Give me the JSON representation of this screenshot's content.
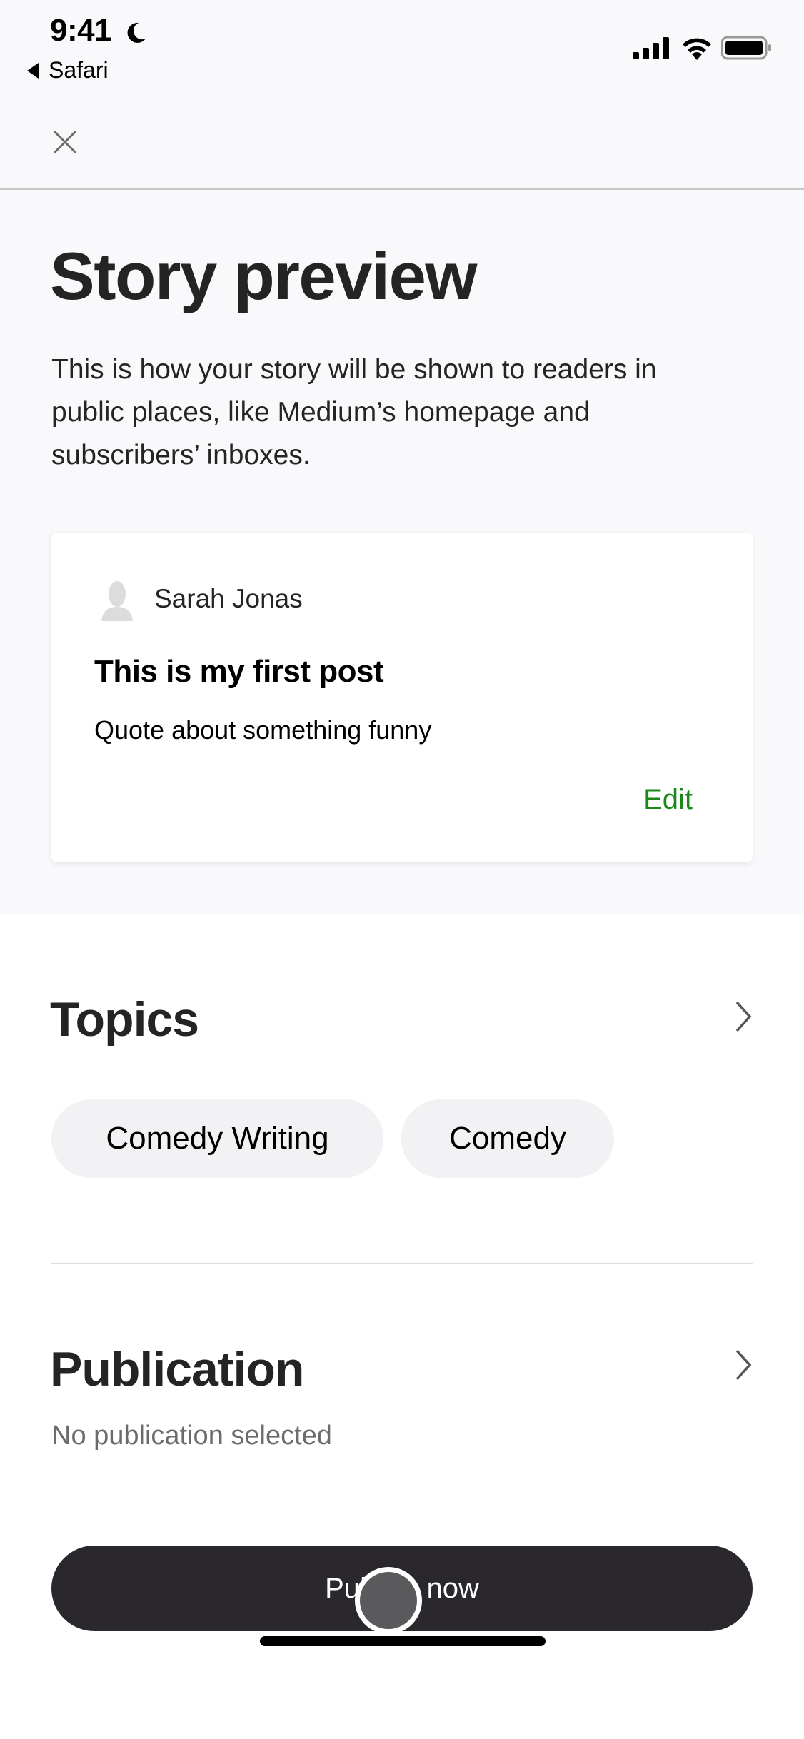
{
  "status_bar": {
    "time": "9:41",
    "back_app": "Safari",
    "icons": [
      "moon-icon",
      "signal-icon",
      "wifi-icon",
      "battery-icon"
    ]
  },
  "header": {
    "close_icon": "close-icon"
  },
  "intro": {
    "title": "Story preview",
    "description": "This is how your story will be shown to readers in public places, like Medium’s homepage and subscribers’ inboxes."
  },
  "preview_card": {
    "author": "Sarah Jonas",
    "post_title": "This is my first post",
    "post_subtitle": "Quote about something funny",
    "edit_label": "Edit"
  },
  "topics": {
    "title": "Topics",
    "chips": [
      "Comedy Writing",
      "Comedy"
    ]
  },
  "publication": {
    "title": "Publication",
    "subtitle": "No publication selected"
  },
  "actions": {
    "publish_label": "Publish now"
  },
  "colors": {
    "accent_green": "#1a8917",
    "button_dark": "#2a282c",
    "top_background": "#f9f8fb",
    "chip_background": "#f2f1f4"
  }
}
